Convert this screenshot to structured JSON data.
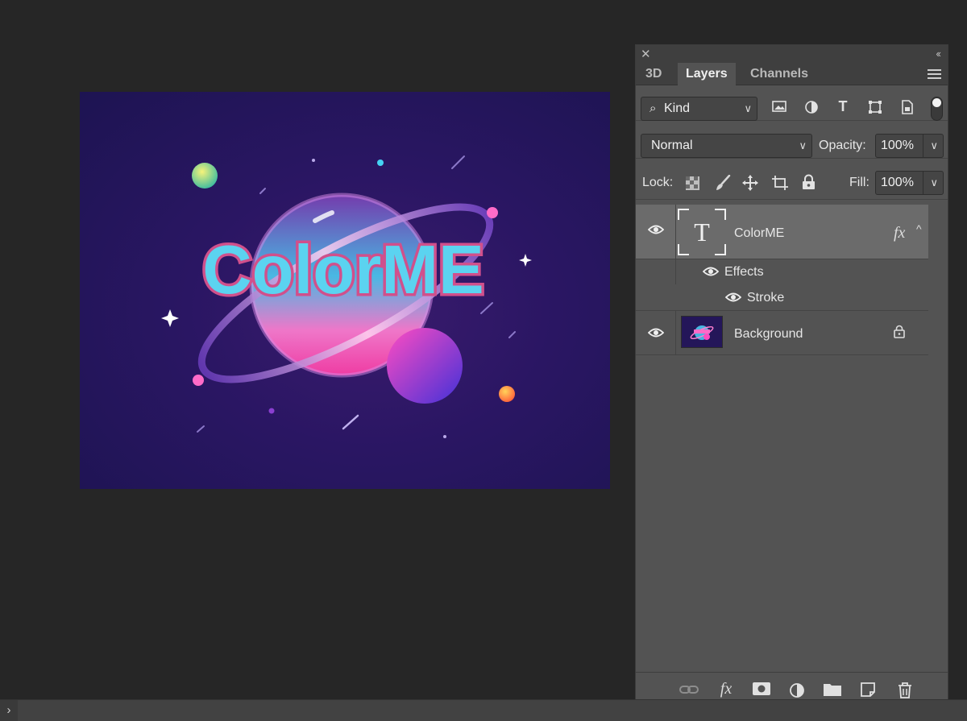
{
  "canvas": {
    "art_title": "ColorME"
  },
  "panel": {
    "tabs": [
      {
        "label": "3D"
      },
      {
        "label": "Layers"
      },
      {
        "label": "Channels"
      }
    ],
    "filter": {
      "kind_label": "Kind"
    },
    "blend_mode": "Normal",
    "opacity": {
      "label": "Opacity:",
      "value": "100%"
    },
    "lock": {
      "label": "Lock:"
    },
    "fill": {
      "label": "Fill:",
      "value": "100%"
    },
    "layers": [
      {
        "name": "ColorME",
        "fx": "fx",
        "effects_label": "Effects",
        "effect": "Stroke"
      },
      {
        "name": "Background"
      }
    ]
  },
  "colors": {
    "accent_text": "#5bd3f0",
    "stroke": "#d0508c",
    "panel_bg": "#535353"
  }
}
